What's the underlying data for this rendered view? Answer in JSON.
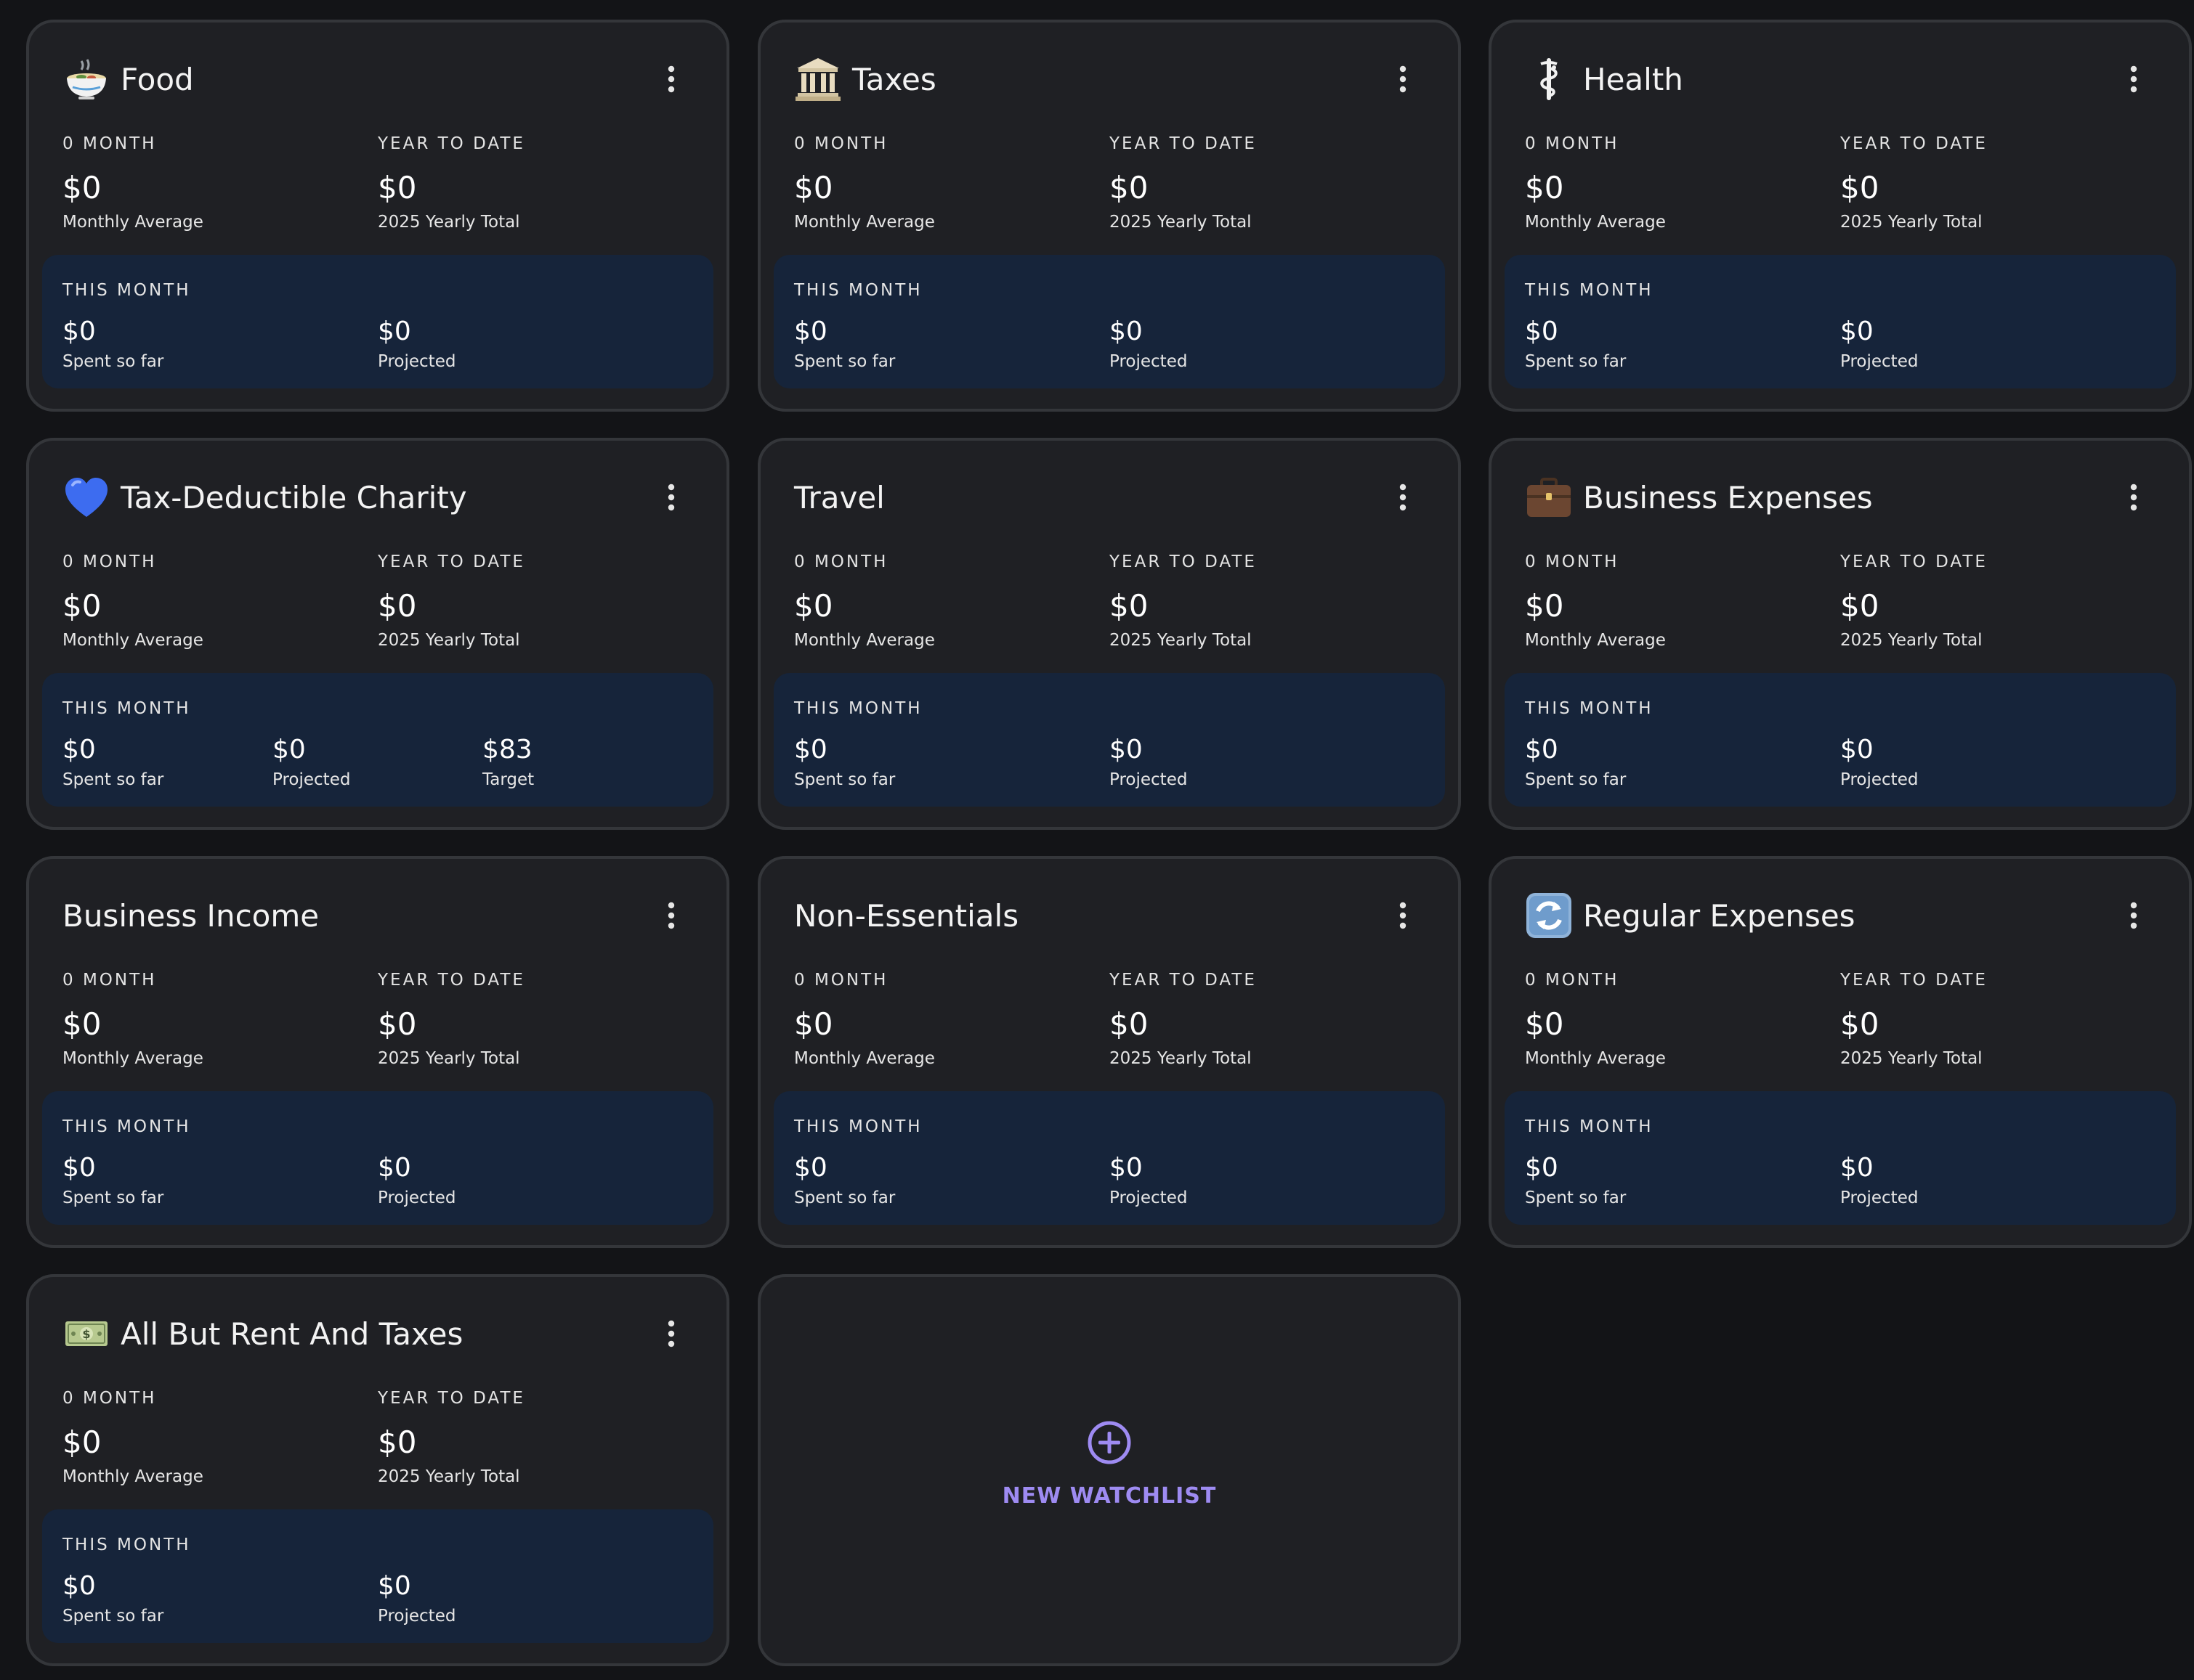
{
  "watchlists": [
    {
      "title": "Food",
      "icon": "bowl-icon",
      "stats": [
        {
          "label": "0 MONTH",
          "value": "$0",
          "sub": "Monthly Average"
        },
        {
          "label": "YEAR TO DATE",
          "value": "$0",
          "sub": "2025 Yearly Total"
        }
      ],
      "month": {
        "label": "THIS MONTH",
        "cols": [
          {
            "value": "$0",
            "sub": "Spent so far"
          },
          {
            "value": "$0",
            "sub": "Projected"
          }
        ]
      }
    },
    {
      "title": "Taxes",
      "icon": "bank-building-icon",
      "stats": [
        {
          "label": "0 MONTH",
          "value": "$0",
          "sub": "Monthly Average"
        },
        {
          "label": "YEAR TO DATE",
          "value": "$0",
          "sub": "2025 Yearly Total"
        }
      ],
      "month": {
        "label": "THIS MONTH",
        "cols": [
          {
            "value": "$0",
            "sub": "Spent so far"
          },
          {
            "value": "$0",
            "sub": "Projected"
          }
        ]
      }
    },
    {
      "title": "Health",
      "icon": "medical-staff-icon",
      "stats": [
        {
          "label": "0 MONTH",
          "value": "$0",
          "sub": "Monthly Average"
        },
        {
          "label": "YEAR TO DATE",
          "value": "$0",
          "sub": "2025 Yearly Total"
        }
      ],
      "month": {
        "label": "THIS MONTH",
        "cols": [
          {
            "value": "$0",
            "sub": "Spent so far"
          },
          {
            "value": "$0",
            "sub": "Projected"
          }
        ]
      }
    },
    {
      "title": "Tax-Deductible Charity",
      "icon": "blue-heart-icon",
      "stats": [
        {
          "label": "0 MONTH",
          "value": "$0",
          "sub": "Monthly Average"
        },
        {
          "label": "YEAR TO DATE",
          "value": "$0",
          "sub": "2025 Yearly Total"
        }
      ],
      "month": {
        "label": "THIS MONTH",
        "cols": [
          {
            "value": "$0",
            "sub": "Spent so far"
          },
          {
            "value": "$0",
            "sub": "Projected"
          },
          {
            "value": "$83",
            "sub": "Target"
          }
        ]
      }
    },
    {
      "title": "Travel",
      "icon": "",
      "stats": [
        {
          "label": "0 MONTH",
          "value": "$0",
          "sub": "Monthly Average"
        },
        {
          "label": "YEAR TO DATE",
          "value": "$0",
          "sub": "2025 Yearly Total"
        }
      ],
      "month": {
        "label": "THIS MONTH",
        "cols": [
          {
            "value": "$0",
            "sub": "Spent so far"
          },
          {
            "value": "$0",
            "sub": "Projected"
          }
        ]
      }
    },
    {
      "title": "Business Expenses",
      "icon": "briefcase-icon",
      "stats": [
        {
          "label": "0 MONTH",
          "value": "$0",
          "sub": "Monthly Average"
        },
        {
          "label": "YEAR TO DATE",
          "value": "$0",
          "sub": "2025 Yearly Total"
        }
      ],
      "month": {
        "label": "THIS MONTH",
        "cols": [
          {
            "value": "$0",
            "sub": "Spent so far"
          },
          {
            "value": "$0",
            "sub": "Projected"
          }
        ]
      }
    },
    {
      "title": "Business Income",
      "icon": "",
      "stats": [
        {
          "label": "0 MONTH",
          "value": "$0",
          "sub": "Monthly Average"
        },
        {
          "label": "YEAR TO DATE",
          "value": "$0",
          "sub": "2025 Yearly Total"
        }
      ],
      "month": {
        "label": "THIS MONTH",
        "cols": [
          {
            "value": "$0",
            "sub": "Spent so far"
          },
          {
            "value": "$0",
            "sub": "Projected"
          }
        ]
      }
    },
    {
      "title": "Non-Essentials",
      "icon": "",
      "stats": [
        {
          "label": "0 MONTH",
          "value": "$0",
          "sub": "Monthly Average"
        },
        {
          "label": "YEAR TO DATE",
          "value": "$0",
          "sub": "2025 Yearly Total"
        }
      ],
      "month": {
        "label": "THIS MONTH",
        "cols": [
          {
            "value": "$0",
            "sub": "Spent so far"
          },
          {
            "value": "$0",
            "sub": "Projected"
          }
        ]
      }
    },
    {
      "title": "Regular Expenses",
      "icon": "refresh-arrows-icon",
      "stats": [
        {
          "label": "0 MONTH",
          "value": "$0",
          "sub": "Monthly Average"
        },
        {
          "label": "YEAR TO DATE",
          "value": "$0",
          "sub": "2025 Yearly Total"
        }
      ],
      "month": {
        "label": "THIS MONTH",
        "cols": [
          {
            "value": "$0",
            "sub": "Spent so far"
          },
          {
            "value": "$0",
            "sub": "Projected"
          }
        ]
      }
    },
    {
      "title": "All But Rent And Taxes",
      "icon": "dollar-banknote-icon",
      "stats": [
        {
          "label": "0 MONTH",
          "value": "$0",
          "sub": "Monthly Average"
        },
        {
          "label": "YEAR TO DATE",
          "value": "$0",
          "sub": "2025 Yearly Total"
        }
      ],
      "month": {
        "label": "THIS MONTH",
        "cols": [
          {
            "value": "$0",
            "sub": "Spent so far"
          },
          {
            "value": "$0",
            "sub": "Projected"
          }
        ]
      }
    }
  ],
  "new_watchlist": {
    "label": "NEW WATCHLIST",
    "icon": "plus-circle-icon"
  },
  "colors": {
    "page_background": "#131417",
    "card_background": "#1f2024",
    "card_border": "#34363a",
    "month_panel": "#16243a",
    "accent": "#9e8bf2",
    "text": "#ffffff"
  }
}
